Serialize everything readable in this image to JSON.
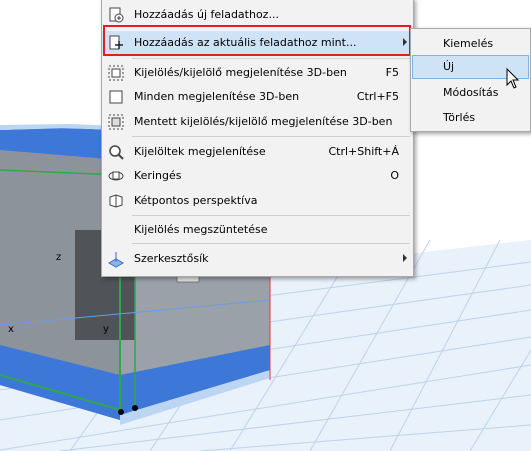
{
  "menu": {
    "items": [
      {
        "label": "Hozzáadás új feladathoz...",
        "shortcut": "",
        "icon": "add-to-new-task-icon"
      },
      {
        "label": "Hozzáadás az aktuális feladathoz mint...",
        "shortcut": "",
        "icon": "add-to-current-task-icon"
      },
      {
        "label": "Kijelölés/kijelölő megjelenítése 3D-ben",
        "shortcut": "F5",
        "icon": "show-selection-3d-icon"
      },
      {
        "label": "Minden megjelenítése 3D-ben",
        "shortcut": "Ctrl+F5",
        "icon": "show-all-3d-icon"
      },
      {
        "label": "Mentett kijelölés/kijelölő megjelenítése 3D-ben",
        "shortcut": "",
        "icon": "show-saved-selection-3d-icon"
      },
      {
        "label": "Kijelöltek megjelenítése",
        "shortcut": "Ctrl+Shift+Á",
        "icon": "show-selected-icon"
      },
      {
        "label": "Keringés",
        "shortcut": "O",
        "icon": "orbit-icon"
      },
      {
        "label": "Kétpontos perspektíva",
        "shortcut": "",
        "icon": "two-point-perspective-icon"
      },
      {
        "label": "Kijelölés megszüntetése",
        "shortcut": "",
        "icon": ""
      },
      {
        "label": "Szerkesztősík",
        "shortcut": "",
        "icon": "editing-plane-icon"
      }
    ]
  },
  "submenu": {
    "items": [
      "Kiemelés",
      "Új",
      "Módosítás",
      "Törlés"
    ]
  },
  "viewport": {
    "axis_x": "x",
    "axis_y": "y",
    "axis_z": "z"
  },
  "colors": {
    "highlight_border": "#e02020",
    "hover_bg": "#cfe3f7",
    "model_blue": "#3d78d8"
  }
}
